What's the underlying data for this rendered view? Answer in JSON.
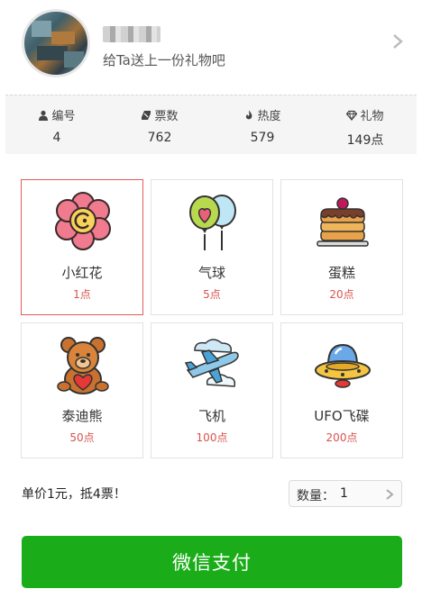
{
  "profile": {
    "subtitle": "给Ta送上一份礼物吧"
  },
  "stats": [
    {
      "icon": "person-icon",
      "label": "编号",
      "value": "4"
    },
    {
      "icon": "ticket-icon",
      "label": "票数",
      "value": "762"
    },
    {
      "icon": "flame-icon",
      "label": "热度",
      "value": "579"
    },
    {
      "icon": "diamond-icon",
      "label": "礼物",
      "value": "149点"
    }
  ],
  "gifts": [
    {
      "name": "小红花",
      "price": "1点",
      "icon": "flower-icon",
      "selected": true
    },
    {
      "name": "气球",
      "price": "5点",
      "icon": "balloon-icon",
      "selected": false
    },
    {
      "name": "蛋糕",
      "price": "20点",
      "icon": "cake-icon",
      "selected": false
    },
    {
      "name": "泰迪熊",
      "price": "50点",
      "icon": "teddy-bear-icon",
      "selected": false
    },
    {
      "name": "飞机",
      "price": "100点",
      "icon": "airplane-icon",
      "selected": false
    },
    {
      "name": "UFO飞碟",
      "price": "200点",
      "icon": "ufo-icon",
      "selected": false
    }
  ],
  "purchase": {
    "unit_note": "单价1元，抵4票！",
    "quantity_label": "数量：",
    "quantity_value": "1",
    "pay_label": "微信支付"
  },
  "colors": {
    "accent_green": "#1aad19",
    "selected_border": "#e25a5a",
    "price_red": "#d9534f"
  }
}
